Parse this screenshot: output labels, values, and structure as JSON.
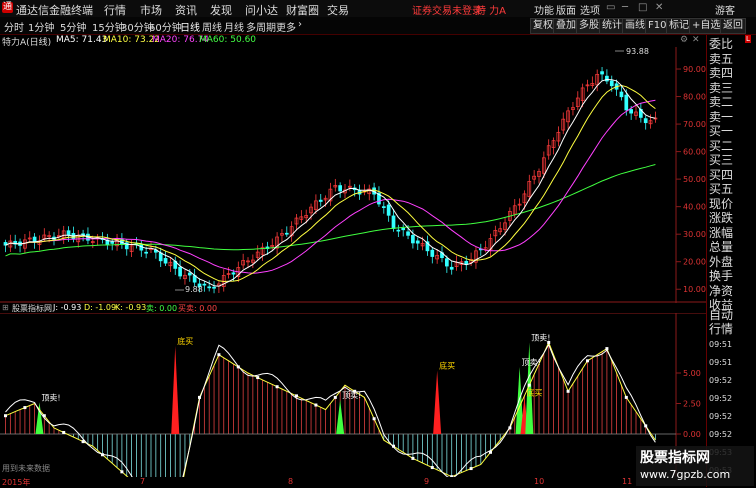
{
  "menubar": {
    "app_title": "通达信金融终端",
    "menus": [
      "行情",
      "市场",
      "资讯",
      "发现",
      "问小达",
      "财富圈",
      "交易"
    ],
    "notice": "证券交易未登录",
    "stock_name": "特 力A",
    "right_menus": [
      "功能",
      "版面",
      "选项"
    ],
    "user": "游客"
  },
  "toolbar": {
    "periods": [
      "分时",
      "1分钟",
      "5分钟",
      "15分钟",
      "30分钟",
      "60分钟",
      "日线",
      "周线",
      "月线",
      "多周期",
      "更多"
    ],
    "active_period": "日线",
    "right_tabs": [
      "复权",
      "叠加",
      "多股",
      "统计",
      "画线",
      "F10",
      "标记",
      "+自选",
      "返回"
    ]
  },
  "chart_header": {
    "name": "特力A(日线)",
    "ma5": "MA5: 71.43",
    "ma10": "MA10: 73.22",
    "ma20": "MA20: 76.74",
    "ma60": "MA60: 50.60"
  },
  "price_axis": [
    "90.00",
    "80.00",
    "70.00",
    "60.00",
    "50.00",
    "40.00",
    "30.00",
    "20.00",
    "10.00"
  ],
  "annotations": {
    "high": "93.88",
    "low": "9.88"
  },
  "indicator_header": {
    "name": "股票指标网",
    "j": "J: -0.93",
    "d": "D: -1.09",
    "k": "K: -0.93",
    "sell": "卖: 0.00",
    "buy": "买卖: 0.00"
  },
  "indicator_axis": [
    "5.00",
    "2.50",
    "0.00"
  ],
  "signals": [
    "顶卖!",
    "底买",
    "顶卖!",
    "底买",
    "顶卖!",
    "底买",
    "顶卖!"
  ],
  "no_data": "用到未来数据",
  "dates": [
    "2015年",
    "7",
    "8",
    "9",
    "10",
    "11"
  ],
  "sidebar": {
    "labels": [
      "委比",
      "卖五",
      "卖四",
      "卖三",
      "卖二",
      "卖一",
      "买一",
      "买二",
      "买三",
      "买四",
      "买五",
      "现价",
      "涨跌",
      "涨幅",
      "总量",
      "外盘",
      "换手",
      "净资",
      "收益"
    ],
    "auto": "自动",
    "tick_title": "行情",
    "times": [
      "09:51",
      "09:51",
      "09:52",
      "09:52",
      "09:52",
      "09:52",
      "09:53",
      "09:53"
    ]
  },
  "watermark": {
    "line1": "股票指标网",
    "line2": "www.7gpzb.com"
  },
  "colors": {
    "up": "#ff3b3b",
    "down": "#3ff",
    "ma5": "#ffffff",
    "ma10": "#ffff40",
    "ma20": "#ff40ff",
    "ma60": "#40ff40",
    "axis": "#b22222"
  }
}
